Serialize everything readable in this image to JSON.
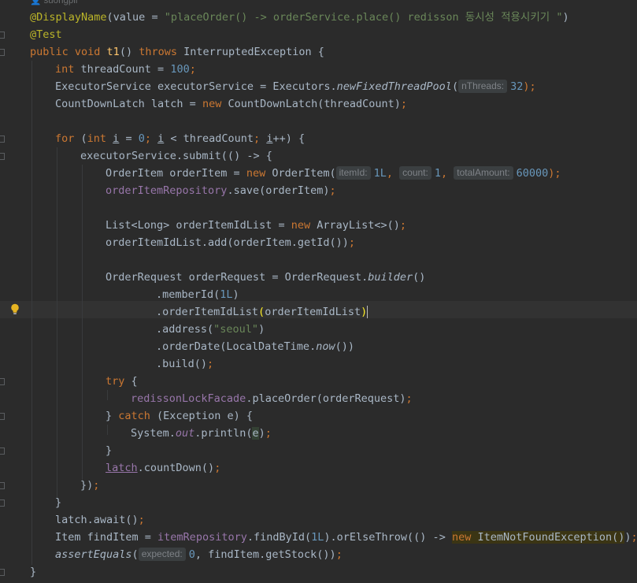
{
  "editor": {
    "author": "suongpil",
    "lines": {
      "l1_ann": "@DisplayName",
      "l1_a": "(value = ",
      "l1_str": "\"placeOrder() -> orderService.place() redisson 동시성 적용시키기 \"",
      "l1_b": ")",
      "l2_ann": "@Test",
      "l3_k1": "public void ",
      "l3_fn": "t1",
      "l3_a": "() ",
      "l3_k2": "throws ",
      "l3_b": "InterruptedException {",
      "l4_k": "int ",
      "l4_a": "threadCount = ",
      "l4_n": "100",
      "l4_sc": ";",
      "l5_a": "ExecutorService executorService = Executors.",
      "l5_fn": "newFixedThreadPool",
      "l5_b": "(",
      "l5_hint": "nThreads:",
      "l5_n": "32",
      "l5_c": ");",
      "l6_a": "CountDownLatch latch = ",
      "l6_k": "new ",
      "l6_b": "CountDownLatch(threadCount)",
      "l6_sc": ";",
      "l8_k1": "for ",
      "l8_a": "(",
      "l8_k2": "int ",
      "l8_i1": "i",
      "l8_b": " = ",
      "l8_n": "0",
      "l8_sc1": "; ",
      "l8_i2": "i",
      "l8_c": " < threadCount",
      "l8_sc2": "; ",
      "l8_i3": "i",
      "l8_d": "++) {",
      "l9": "executorService.submit(() -> {",
      "l10_a": "OrderItem orderItem = ",
      "l10_k": "new ",
      "l10_b": "OrderItem(",
      "l10_h1": "itemId:",
      "l10_n1": "1L",
      "l10_c1": ", ",
      "l10_h2": "count:",
      "l10_n2": "1",
      "l10_c2": ", ",
      "l10_h3": "totalAmount:",
      "l10_n3": "60000",
      "l10_e": ");",
      "l11_p": "orderItemRepository",
      "l11_a": ".save(orderItem)",
      "l11_sc": ";",
      "l13_a": "List<Long> orderItemIdList = ",
      "l13_k": "new ",
      "l13_b": "ArrayList<>()",
      "l13_sc": ";",
      "l14_a": "orderItemIdList.add(orderItem.getId())",
      "l14_sc": ";",
      "l16_a": "OrderRequest orderRequest = OrderRequest.",
      "l16_fn": "builder",
      "l16_b": "()",
      "l17_a": ".memberId(",
      "l17_n": "1L",
      "l17_b": ")",
      "l18_a": ".orderItemIdList",
      "l18_p1": "(",
      "l18_b": "orderItemIdList",
      "l18_p2": ")",
      "l19_a": ".address(",
      "l19_s": "\"seoul\"",
      "l19_b": ")",
      "l20_a": ".orderDate(LocalDateTime.",
      "l20_fn": "now",
      "l20_b": "())",
      "l21_a": ".build()",
      "l21_sc": ";",
      "l22_k": "try ",
      "l22_a": "{",
      "l23_p": "redissonLockFacade",
      "l23_a": ".placeOrder(orderRequest)",
      "l23_sc": ";",
      "l24_a": "} ",
      "l24_k": "catch ",
      "l24_b": "(Exception e) {",
      "l25_a": "System.",
      "l25_p": "out",
      "l25_b": ".println(",
      "l25_e": "e",
      "l25_c": ")",
      "l25_sc": ";",
      "l26": "}",
      "l27_u": "latch",
      "l27_a": ".countDown()",
      "l27_sc": ";",
      "l28_a": "})",
      "l28_sc": ";",
      "l29": "}",
      "l30_a": "latch.await()",
      "l30_sc": ";",
      "l31_a": "Item findItem = ",
      "l31_p": "itemRepository",
      "l31_b": ".findById(",
      "l31_n": "1L",
      "l31_c": ").orElseThrow(() -> ",
      "l31_k": "new ",
      "l31_d": "ItemNotFoundException()",
      "l31_e": ")",
      "l31_sc": ";",
      "l32_fn": "assertEquals",
      "l32_a": "(",
      "l32_hint": "expected:",
      "l32_n": "0",
      "l32_b": ", findItem.getStock())",
      "l32_sc": ";",
      "l33": "}"
    }
  },
  "colors": {
    "background": "#2b2b2b",
    "keyword": "#cc7832",
    "number": "#6897bb",
    "string": "#6a8759",
    "annotation": "#bbb529",
    "method_decl": "#ffc66d",
    "field": "#9876aa",
    "text": "#a9b7c6"
  }
}
